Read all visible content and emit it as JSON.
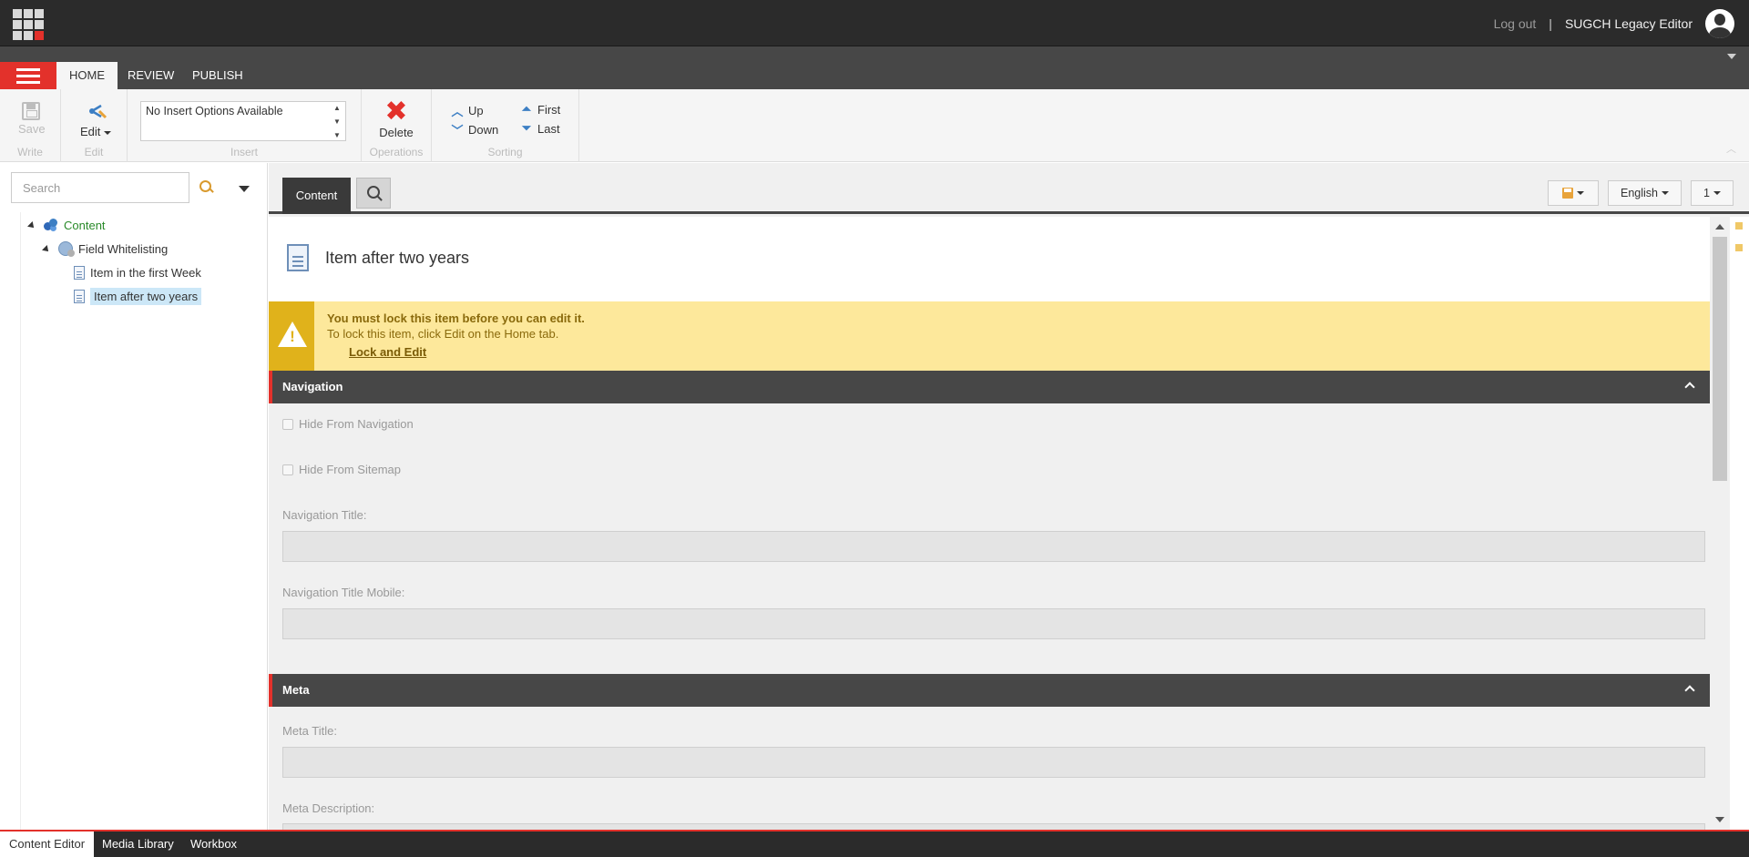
{
  "topbar": {
    "logout": "Log out",
    "separator": "|",
    "username": "SUGCH Legacy Editor"
  },
  "ribbon": {
    "tabs": [
      "HOME",
      "REVIEW",
      "PUBLISH"
    ],
    "groups": {
      "write": {
        "label": "Write",
        "save": "Save"
      },
      "edit": {
        "label": "Edit",
        "edit": "Edit"
      },
      "insert": {
        "label": "Insert",
        "options": "No Insert Options Available"
      },
      "operations": {
        "label": "Operations",
        "delete": "Delete"
      },
      "sorting": {
        "label": "Sorting",
        "up": "Up",
        "down": "Down",
        "first": "First",
        "last": "Last"
      }
    }
  },
  "tree": {
    "search_placeholder": "Search",
    "nodes": [
      {
        "label": "Content",
        "icon": "content-icon"
      },
      {
        "label": "Field Whitelisting",
        "icon": "globe-icon"
      },
      {
        "label": "Item in the first Week",
        "icon": "document-icon"
      },
      {
        "label": "Item after two years",
        "icon": "document-icon",
        "selected": true
      }
    ]
  },
  "editor": {
    "tab_content": "Content",
    "language": "English",
    "version": "1",
    "item_title": "Item after two years",
    "warning": {
      "title": "You must lock this item before you can edit it.",
      "text": "To lock this item, click Edit on the Home tab.",
      "link": "Lock and Edit",
      "icon": "!"
    },
    "sections": {
      "navigation": {
        "title": "Navigation",
        "hide_nav": "Hide From Navigation",
        "hide_sitemap": "Hide From Sitemap",
        "nav_title": "Navigation Title:",
        "nav_title_mobile": "Navigation Title Mobile:"
      },
      "meta": {
        "title": "Meta",
        "meta_title": "Meta Title:",
        "meta_description": "Meta Description:"
      }
    }
  },
  "taskbar": [
    "Content Editor",
    "Media Library",
    "Workbox"
  ],
  "colors": {
    "accent": "#e3312b",
    "dark": "#2b2b2b",
    "warning": "#fde89b"
  }
}
